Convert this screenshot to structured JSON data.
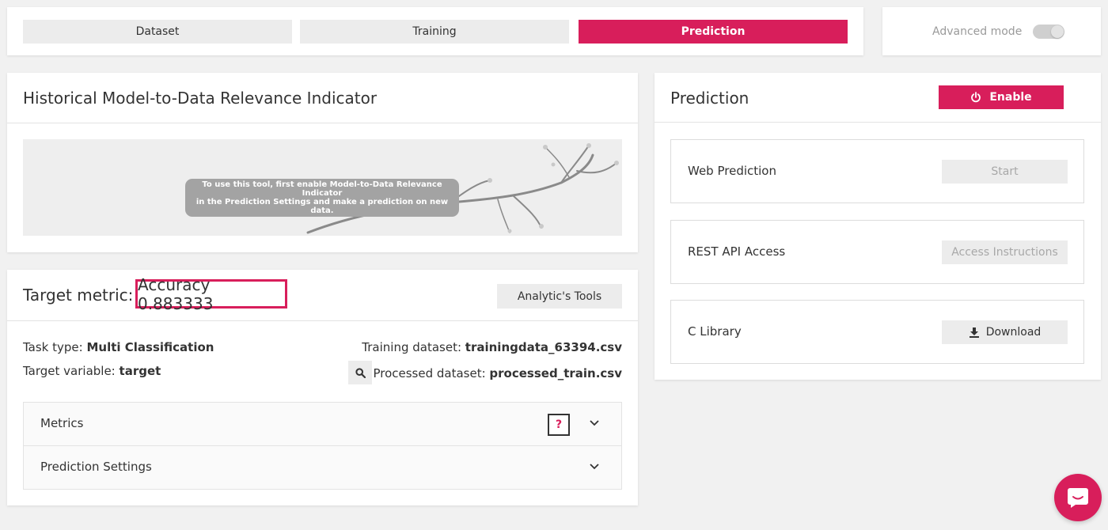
{
  "tabs": [
    {
      "label": "Dataset",
      "active": false
    },
    {
      "label": "Training",
      "active": false
    },
    {
      "label": "Prediction",
      "active": true
    }
  ],
  "advanced_mode": {
    "label": "Advanced mode",
    "enabled": false
  },
  "historical": {
    "title": "Historical Model-to-Data Relevance Indicator",
    "message_line1": "To use this tool, first enable Model-to-Data Relevance Indicator",
    "message_line2": "in the Prediction Settings and make a prediction on new data."
  },
  "metric": {
    "label": "Target metric:",
    "value": "Accuracy 0.883333",
    "analytics_button": "Analytic's Tools",
    "task_type_label": "Task type:",
    "task_type_value": "Multi Classification",
    "target_var_label": "Target variable:",
    "target_var_value": "target",
    "training_dataset_label": "Training dataset:",
    "training_dataset_value": "trainingdata_63394.csv",
    "processed_dataset_label": "Processed dataset:",
    "processed_dataset_value": "processed_train.csv",
    "accordion": [
      {
        "label": "Metrics"
      },
      {
        "label": "Prediction Settings"
      }
    ],
    "help_label": "?"
  },
  "prediction": {
    "title": "Prediction",
    "enable_button": "Enable",
    "options": [
      {
        "label": "Web Prediction",
        "button": "Start",
        "disabled": true
      },
      {
        "label": "REST API Access",
        "button": "Access Instructions",
        "disabled": true
      },
      {
        "label": "C Library",
        "button": "Download",
        "disabled": false
      }
    ]
  },
  "colors": {
    "accent": "#d81e5b",
    "panel_bg": "#ececec",
    "page_bg": "#f1f1f1"
  },
  "icons": {
    "enable": "power-icon",
    "download": "download-icon",
    "search": "search-icon",
    "chevron": "chevron-down-icon",
    "chat": "chat-icon"
  }
}
